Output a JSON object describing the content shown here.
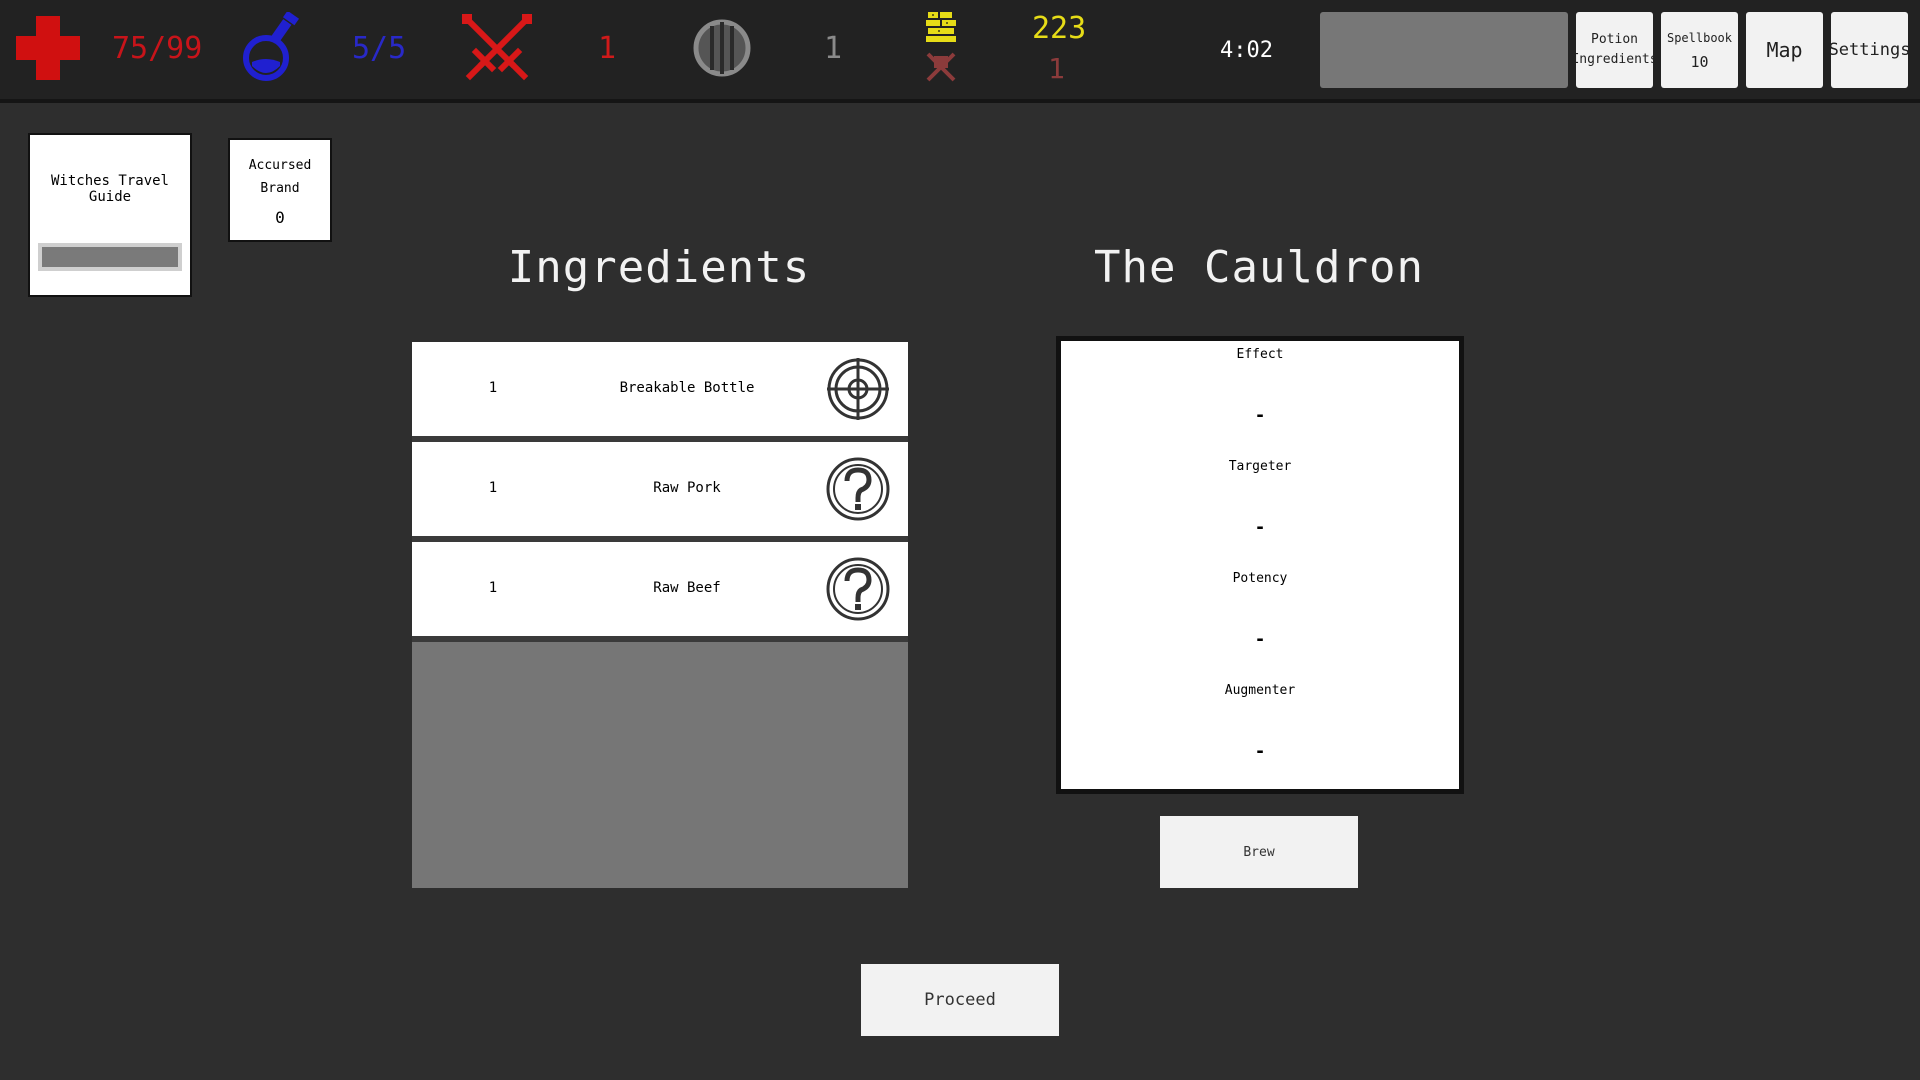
{
  "hud": {
    "health": "75/99",
    "mana": "5/5",
    "attack": "1",
    "defense": "1",
    "gold": "223",
    "kills": "1",
    "timer": "4:02",
    "buttons": {
      "potion_line1": "Potion",
      "potion_line2": "Ingredients",
      "spellbook_label": "Spellbook",
      "spellbook_count": "10",
      "map": "Map",
      "settings": "Settings"
    },
    "colors": {
      "health": "#c8141a",
      "mana": "#2929c8",
      "attack": "#d01a1a",
      "defense": "#8a8a8a",
      "gold": "#e6dc17",
      "kills": "#8c3b3b"
    }
  },
  "relics": {
    "guide": {
      "title": "Witches Travel Guide"
    },
    "brand": {
      "line1": "Accursed",
      "line2": "Brand",
      "count": "0"
    }
  },
  "ingredients": {
    "title": "Ingredients",
    "items": [
      {
        "qty": "1",
        "name": "Breakable Bottle",
        "icon": "crosshair-icon"
      },
      {
        "qty": "1",
        "name": "Raw Pork",
        "icon": "question-mark-icon"
      },
      {
        "qty": "1",
        "name": "Raw Beef",
        "icon": "question-mark-icon"
      }
    ]
  },
  "cauldron": {
    "title": "The Cauldron",
    "slots": [
      {
        "label": "Effect",
        "value": "-"
      },
      {
        "label": "Targeter",
        "value": "-"
      },
      {
        "label": "Potency",
        "value": "-"
      },
      {
        "label": "Augmenter",
        "value": "-"
      }
    ],
    "brew_label": "Brew"
  },
  "proceed_label": "Proceed"
}
